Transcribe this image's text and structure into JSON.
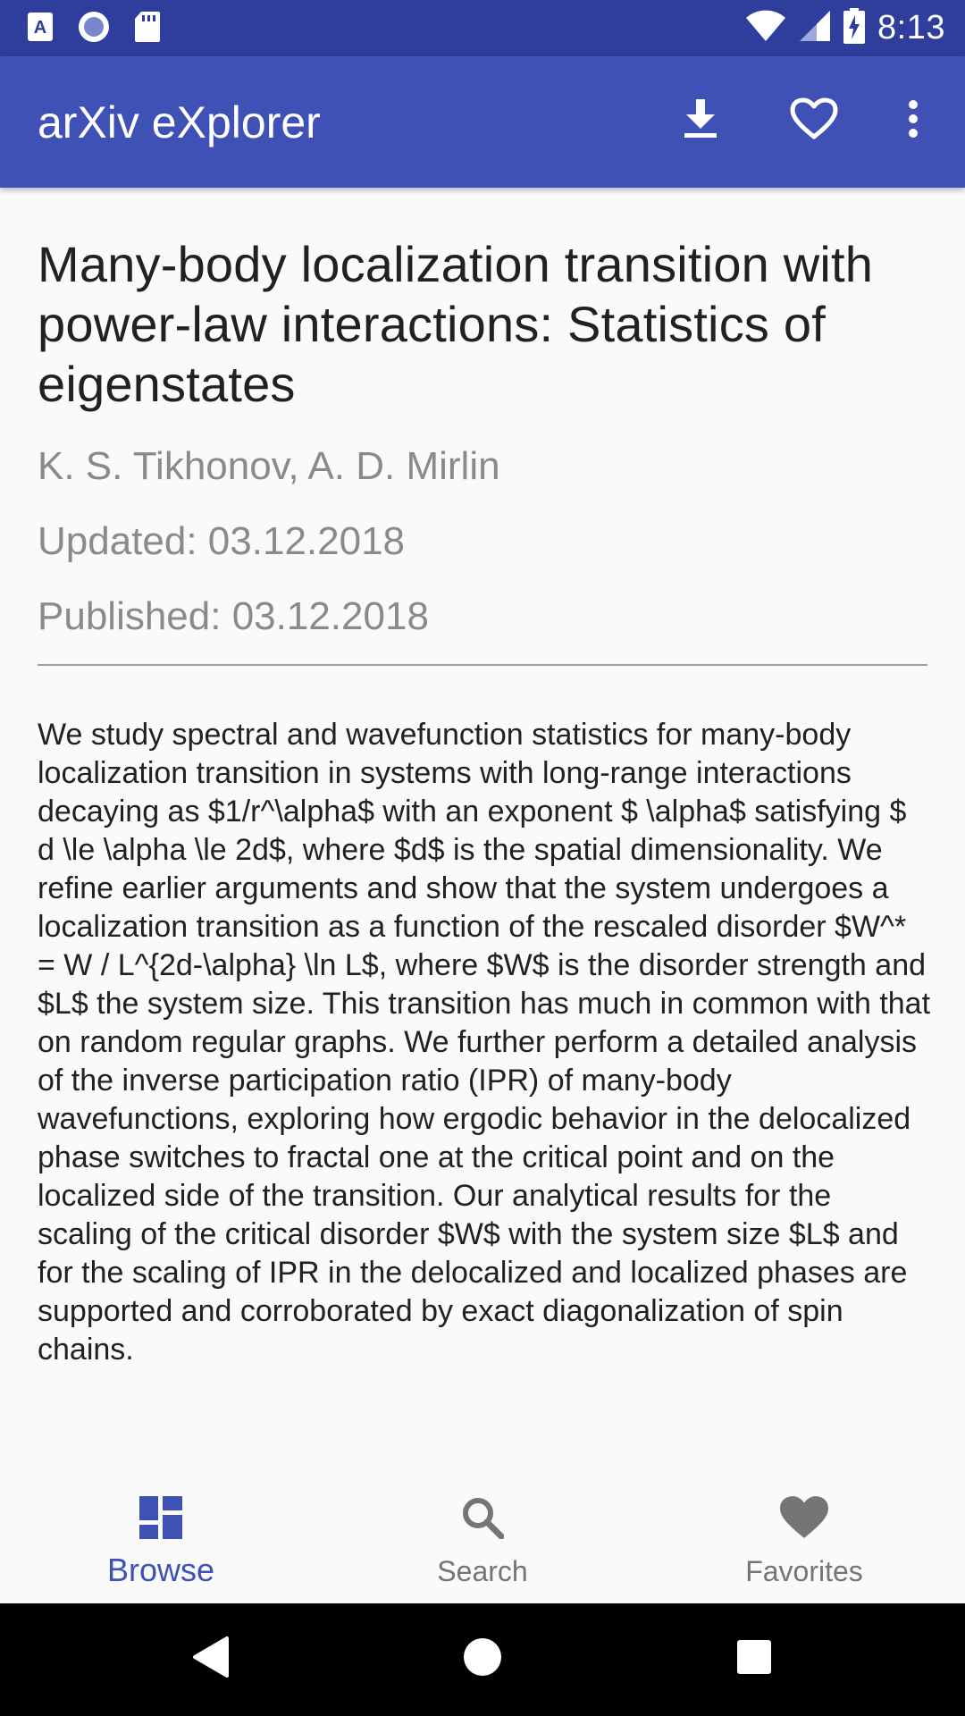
{
  "status_bar": {
    "time": "8:13",
    "left_icons": [
      "accessibility-a-icon",
      "record-circle-icon",
      "sd-card-icon"
    ],
    "right_icons": [
      "wifi-icon",
      "cell-signal-icon",
      "battery-charging-icon"
    ]
  },
  "app_bar": {
    "title": "arXiv eXplorer",
    "actions": [
      "download-icon",
      "heart-outline-icon",
      "more-vert-icon"
    ]
  },
  "paper": {
    "title": "Many-body localization transition with power-law interactions: Statistics of eigenstates",
    "authors": "K. S. Tikhonov, A. D. Mirlin",
    "updated": "Updated: 03.12.2018",
    "published": "Published: 03.12.2018",
    "abstract": "We study spectral and wavefunction statistics for many-body localization transition in systems with long-range interactions decaying as $1/r^\\alpha$ with an exponent $ \\alpha$ satisfying $ d \\le \\alpha \\le 2d$, where $d$ is the spatial dimensionality. We refine earlier arguments and show that the system undergoes a localization transition as a function of the rescaled disorder $W^* = W / L^{2d-\\alpha} \\ln L$, where $W$ is the disorder strength and $L$ the system size. This transition has much in common with that on random regular graphs. We further perform a detailed analysis of the inverse participation ratio (IPR) of many-body wavefunctions, exploring how ergodic behavior in the delocalized phase switches to fractal one at the critical point and on the localized side of the transition. Our analytical results for the scaling of the critical disorder $W$ with the system size $L$ and for the scaling of IPR in the delocalized and localized phases are supported and corroborated by exact diagonalization of spin chains."
  },
  "bottom_nav": {
    "items": [
      {
        "label": "Browse",
        "icon": "dashboard-icon",
        "active": true
      },
      {
        "label": "Search",
        "icon": "search-icon",
        "active": false
      },
      {
        "label": "Favorites",
        "icon": "heart-icon",
        "active": false
      }
    ]
  },
  "system_nav": {
    "buttons": [
      "back-triangle-icon",
      "home-circle-icon",
      "recents-square-icon"
    ]
  },
  "colors": {
    "status_bar": "#2f3d9c",
    "app_bar": "#3f51b5",
    "accent_active": "#3f51b5",
    "inactive": "#757575",
    "meta_text": "#8a8a8a",
    "body_text": "#212121"
  }
}
